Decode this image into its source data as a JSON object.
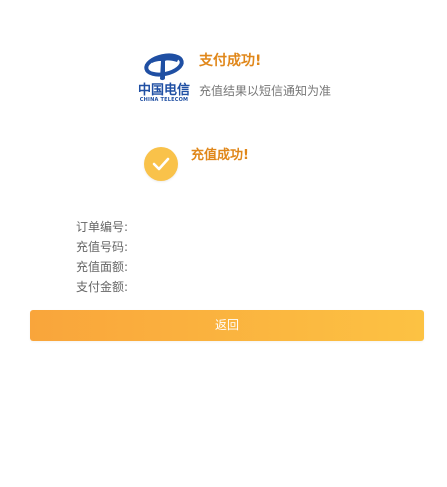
{
  "header": {
    "logo_cn": "中国电信",
    "logo_en": "CHINA TELECOM",
    "title": "支付成功!",
    "subtitle": "充值结果以短信通知为准"
  },
  "recharge": {
    "title": "充值成功!"
  },
  "details": [
    {
      "label": "订单编号:",
      "value": ""
    },
    {
      "label": "充值号码:",
      "value": ""
    },
    {
      "label": "充值面额:",
      "value": ""
    },
    {
      "label": "支付金额:",
      "value": ""
    }
  ],
  "actions": {
    "return_label": "返回"
  },
  "colors": {
    "accent_orange": "#e0871a",
    "button_gradient_start": "#f9a53b",
    "button_gradient_end": "#fcc243",
    "check_circle": "#f9c24a",
    "logo_blue": "#1f4fa3"
  },
  "icons": {
    "logo": "china-telecom-logo",
    "success": "checkmark-icon"
  }
}
